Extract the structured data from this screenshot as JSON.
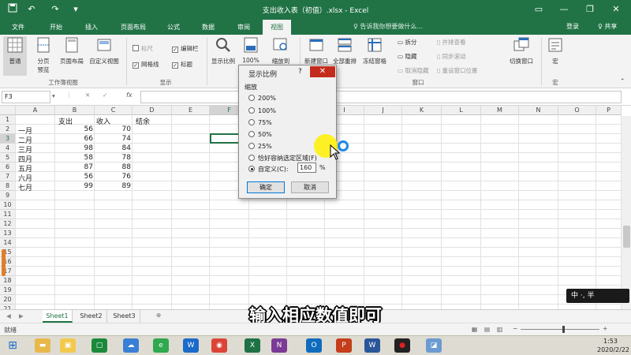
{
  "window": {
    "title": "支出收入表（初值）.xlsx - Excel",
    "quick_access": [
      "save-icon",
      "undo-icon",
      "redo-icon",
      "customize-icon"
    ],
    "controls": [
      "ribbon-options-icon",
      "minimize-icon",
      "restore-icon",
      "close-icon"
    ]
  },
  "ribbon_tabs": [
    "文件",
    "开始",
    "插入",
    "页面布局",
    "公式",
    "数据",
    "审阅",
    "视图"
  ],
  "active_tab": "视图",
  "tell_me": "♀ 告诉我你想要做什么...",
  "login": "登录",
  "share": "♀ 共享",
  "ribbon": {
    "workbook_views": {
      "label": "工作簿视图",
      "normal": "普通",
      "page_break": "分页\n预览",
      "page_layout": "页面布局",
      "custom": "自定义视图"
    },
    "show": {
      "label": "显示",
      "ruler": "标尺",
      "formula_bar": "编辑栏",
      "gridlines": "网格线",
      "headings": "标题"
    },
    "zoom": {
      "label": "显示比例",
      "zoom_btn": "显示比例",
      "hundred": "100%",
      "zoom_selection": "缩放到\n选定区域"
    },
    "window": {
      "label": "窗口",
      "new_window": "新建窗口",
      "arrange_all": "全部重排",
      "freeze_panes": "冻结窗格",
      "split": "拆分",
      "hide": "隐藏",
      "unhide": "取消隐藏",
      "side_by_side": "并排查看",
      "sync_scroll": "同步滚动",
      "reset_position": "重设窗口位置",
      "switch_windows": "切换窗口"
    },
    "macros": {
      "label": "宏",
      "macros_btn": "宏"
    }
  },
  "formula_bar": {
    "name_box": "F3",
    "fx": "fx",
    "content": ""
  },
  "grid": {
    "columns": [
      "A",
      "B",
      "C",
      "D",
      "E",
      "F",
      "G",
      "H",
      "I",
      "J",
      "K",
      "L",
      "M",
      "N",
      "O",
      "P"
    ],
    "rows": [
      "1",
      "2",
      "3",
      "4",
      "5",
      "6",
      "7",
      "8",
      "9",
      "10",
      "11",
      "12",
      "13",
      "14",
      "15",
      "16",
      "17",
      "18",
      "19",
      "20",
      "21",
      "22"
    ],
    "headers": {
      "B1": "支出",
      "C1": "收入",
      "D1": "结余"
    },
    "data": [
      {
        "month": "一月",
        "expense": "56",
        "income": "70"
      },
      {
        "month": "二月",
        "expense": "66",
        "income": "74"
      },
      {
        "month": "三月",
        "expense": "98",
        "income": "84"
      },
      {
        "month": "四月",
        "expense": "58",
        "income": "78"
      },
      {
        "month": "五月",
        "expense": "87",
        "income": "88"
      },
      {
        "month": "六月",
        "expense": "56",
        "income": "76"
      },
      {
        "month": "七月",
        "expense": "99",
        "income": "89"
      }
    ],
    "selected_cell": "F3"
  },
  "sheets": [
    "Sheet1",
    "Sheet2",
    "Sheet3"
  ],
  "active_sheet": "Sheet1",
  "status": "就绪",
  "zoom_dialog": {
    "title": "显示比例",
    "help": "?",
    "close": "✕",
    "group_label": "缩放",
    "options": [
      "200%",
      "100%",
      "75%",
      "50%",
      "25%",
      "恰好容纳选定区域(F)",
      "自定义(C):"
    ],
    "selected_option": "自定义(C):",
    "custom_value": "160",
    "percent_sign": "%",
    "ok": "确定",
    "cancel": "取消"
  },
  "caption": "输入相应数值即可",
  "ime": "中 ·, 半",
  "taskbar": {
    "icons": [
      "start-icon",
      "file-explorer-icon",
      "store-icon",
      "baidu-netdisk-icon",
      "ie-icon",
      "wps-icon",
      "chrome-icon",
      "excel-icon",
      "onenote-icon",
      "outlook-icon",
      "powerpoint-icon",
      "word-icon",
      "record-icon",
      "screenshot-icon"
    ],
    "time": "1:53",
    "date": "2020/2/22"
  },
  "colors": {
    "excel_green": "#217346",
    "dialog_close_red": "#c42b1c",
    "highlight_yellow": "#fff000",
    "caption_white": "#ffffff"
  }
}
